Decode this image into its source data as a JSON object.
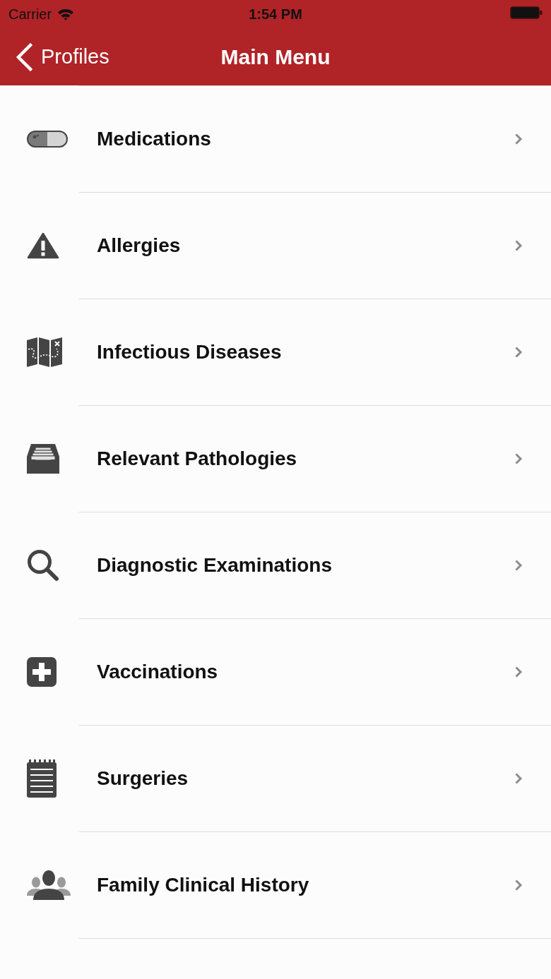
{
  "status_bar": {
    "carrier": "Carrier",
    "time": "1:54 PM"
  },
  "nav_bar": {
    "back": "Profiles",
    "title": "Main Menu"
  },
  "menu": {
    "items": [
      {
        "kind": "pill",
        "label": "Medications"
      },
      {
        "kind": "warning",
        "label": "Allergies"
      },
      {
        "kind": "map",
        "label": "Infectious Diseases"
      },
      {
        "kind": "drawer",
        "label": "Relevant Pathologies"
      },
      {
        "kind": "search",
        "label": "Diagnostic Examinations"
      },
      {
        "kind": "plus",
        "label": "Vaccinations"
      },
      {
        "kind": "notepad",
        "label": "Surgeries"
      },
      {
        "kind": "people",
        "label": "Family Clinical History"
      }
    ]
  }
}
